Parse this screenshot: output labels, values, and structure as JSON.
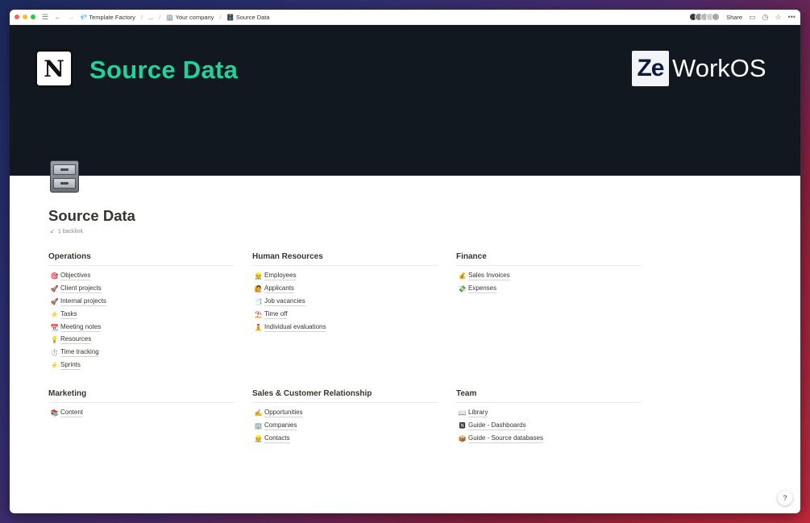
{
  "breadcrumb": [
    {
      "icon": "💎",
      "label": "Template Factory"
    },
    {
      "icon": "",
      "label": "..."
    },
    {
      "icon": "🏢",
      "label": "Your company"
    },
    {
      "icon": "🗄️",
      "label": "Source Data"
    }
  ],
  "topbar": {
    "share_label": "Share"
  },
  "cover": {
    "title": "Source Data",
    "notion_logo_letter": "N",
    "brand_logo_text": "Ze",
    "brand_name": "WorkOS"
  },
  "page": {
    "icon": "file-cabinet-icon",
    "title": "Source Data",
    "backlinks": "1 backlink"
  },
  "sections": [
    {
      "title": "Operations",
      "items": [
        {
          "emoji": "🎯",
          "label": "Objectives"
        },
        {
          "emoji": "🚀",
          "label": "Client projects"
        },
        {
          "emoji": "🚀",
          "label": "Internal projects"
        },
        {
          "emoji": "⚡",
          "label": "Tasks"
        },
        {
          "emoji": "📆",
          "label": "Meeting notes"
        },
        {
          "emoji": "💡",
          "label": "Resources"
        },
        {
          "emoji": "⏱️",
          "label": "Time tracking"
        },
        {
          "emoji": "⚡",
          "label": "Sprints"
        }
      ]
    },
    {
      "title": "Human Resources",
      "items": [
        {
          "emoji": "👷",
          "label": "Employees"
        },
        {
          "emoji": "🙋",
          "label": "Applicants"
        },
        {
          "emoji": "📑",
          "label": "Job vacancies"
        },
        {
          "emoji": "⛱️",
          "label": "Time off"
        },
        {
          "emoji": "🧘",
          "label": "Individual evaluations"
        }
      ]
    },
    {
      "title": "Finance",
      "items": [
        {
          "emoji": "💰",
          "label": "Sales Invoices"
        },
        {
          "emoji": "💸",
          "label": "Expenses"
        }
      ]
    },
    {
      "title": "Marketing",
      "items": [
        {
          "emoji": "📚",
          "label": "Content"
        }
      ]
    },
    {
      "title": "Sales & Customer Relationship",
      "items": [
        {
          "emoji": "✍️",
          "label": "Opportunities"
        },
        {
          "emoji": "🏢",
          "label": "Companies"
        },
        {
          "emoji": "👷",
          "label": "Contacts"
        }
      ]
    },
    {
      "title": "Team",
      "items": [
        {
          "emoji": "📖",
          "label": "Library"
        },
        {
          "emoji": "🅽",
          "label": "Guide - Dashboards"
        },
        {
          "emoji": "📦",
          "label": "Guide - Source databases"
        }
      ]
    }
  ],
  "help_label": "?",
  "colors": {
    "cover_bg": "#111820",
    "cover_title": "#23d19b",
    "text": "#37352f"
  }
}
